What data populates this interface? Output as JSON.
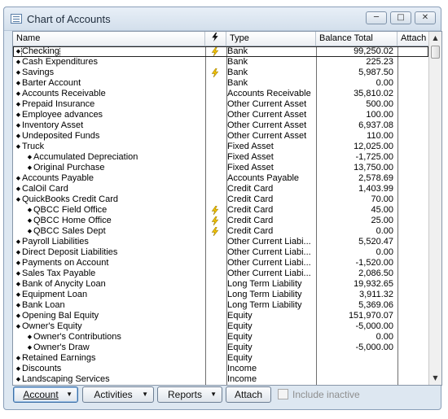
{
  "window": {
    "title": "Chart of Accounts"
  },
  "columns": {
    "name": "Name",
    "type": "Type",
    "balance": "Balance Total",
    "attach": "Attach"
  },
  "rows": [
    {
      "name": "Checking",
      "indent": 0,
      "flag": true,
      "type": "Bank",
      "balance": "99,250.02",
      "selected": true
    },
    {
      "name": "Cash Expenditures",
      "indent": 0,
      "flag": false,
      "type": "Bank",
      "balance": "225.23"
    },
    {
      "name": "Savings",
      "indent": 0,
      "flag": true,
      "type": "Bank",
      "balance": "5,987.50"
    },
    {
      "name": "Barter Account",
      "indent": 0,
      "flag": false,
      "type": "Bank",
      "balance": "0.00"
    },
    {
      "name": "Accounts Receivable",
      "indent": 0,
      "flag": false,
      "type": "Accounts Receivable",
      "balance": "35,810.02"
    },
    {
      "name": "Prepaid Insurance",
      "indent": 0,
      "flag": false,
      "type": "Other Current Asset",
      "balance": "500.00"
    },
    {
      "name": "Employee advances",
      "indent": 0,
      "flag": false,
      "type": "Other Current Asset",
      "balance": "100.00"
    },
    {
      "name": "Inventory Asset",
      "indent": 0,
      "flag": false,
      "type": "Other Current Asset",
      "balance": "6,937.08"
    },
    {
      "name": "Undeposited Funds",
      "indent": 0,
      "flag": false,
      "type": "Other Current Asset",
      "balance": "110.00"
    },
    {
      "name": "Truck",
      "indent": 0,
      "flag": false,
      "type": "Fixed Asset",
      "balance": "12,025.00"
    },
    {
      "name": "Accumulated Depreciation",
      "indent": 1,
      "flag": false,
      "type": "Fixed Asset",
      "balance": "-1,725.00"
    },
    {
      "name": "Original Purchase",
      "indent": 1,
      "flag": false,
      "type": "Fixed Asset",
      "balance": "13,750.00"
    },
    {
      "name": "Accounts Payable",
      "indent": 0,
      "flag": false,
      "type": "Accounts Payable",
      "balance": "2,578.69"
    },
    {
      "name": "CalOil Card",
      "indent": 0,
      "flag": false,
      "type": "Credit Card",
      "balance": "1,403.99"
    },
    {
      "name": "QuickBooks Credit Card",
      "indent": 0,
      "flag": false,
      "type": "Credit Card",
      "balance": "70.00"
    },
    {
      "name": "QBCC Field Office",
      "indent": 1,
      "flag": true,
      "type": "Credit Card",
      "balance": "45.00"
    },
    {
      "name": "QBCC Home Office",
      "indent": 1,
      "flag": true,
      "type": "Credit Card",
      "balance": "25.00"
    },
    {
      "name": "QBCC Sales Dept",
      "indent": 1,
      "flag": true,
      "type": "Credit Card",
      "balance": "0.00"
    },
    {
      "name": "Payroll Liabilities",
      "indent": 0,
      "flag": false,
      "type": "Other Current Liabi...",
      "balance": "5,520.47"
    },
    {
      "name": "Direct Deposit Liabilities",
      "indent": 0,
      "flag": false,
      "type": "Other Current Liabi...",
      "balance": "0.00"
    },
    {
      "name": "Payments on Account",
      "indent": 0,
      "flag": false,
      "type": "Other Current Liabi...",
      "balance": "-1,520.00"
    },
    {
      "name": "Sales Tax Payable",
      "indent": 0,
      "flag": false,
      "type": "Other Current Liabi...",
      "balance": "2,086.50"
    },
    {
      "name": "Bank of Anycity Loan",
      "indent": 0,
      "flag": false,
      "type": "Long Term Liability",
      "balance": "19,932.65"
    },
    {
      "name": "Equipment Loan",
      "indent": 0,
      "flag": false,
      "type": "Long Term Liability",
      "balance": "3,911.32"
    },
    {
      "name": "Bank Loan",
      "indent": 0,
      "flag": false,
      "type": "Long Term Liability",
      "balance": "5,369.06"
    },
    {
      "name": "Opening Bal Equity",
      "indent": 0,
      "flag": false,
      "type": "Equity",
      "balance": "151,970.07"
    },
    {
      "name": "Owner's Equity",
      "indent": 0,
      "flag": false,
      "type": "Equity",
      "balance": "-5,000.00"
    },
    {
      "name": "Owner's Contributions",
      "indent": 1,
      "flag": false,
      "type": "Equity",
      "balance": "0.00"
    },
    {
      "name": "Owner's Draw",
      "indent": 1,
      "flag": false,
      "type": "Equity",
      "balance": "-5,000.00"
    },
    {
      "name": "Retained Earnings",
      "indent": 0,
      "flag": false,
      "type": "Equity",
      "balance": ""
    },
    {
      "name": "Discounts",
      "indent": 0,
      "flag": false,
      "type": "Income",
      "balance": ""
    },
    {
      "name": "Landscaping Services",
      "indent": 0,
      "flag": false,
      "type": "Income",
      "balance": ""
    }
  ],
  "footer": {
    "account_label": "Account",
    "activities_label": "Activities",
    "reports_label": "Reports",
    "attach_label": "Attach",
    "include_inactive_label": "Include inactive"
  },
  "colors": {
    "window_bg": "#dde7f1",
    "bolt": "#f2c200"
  }
}
